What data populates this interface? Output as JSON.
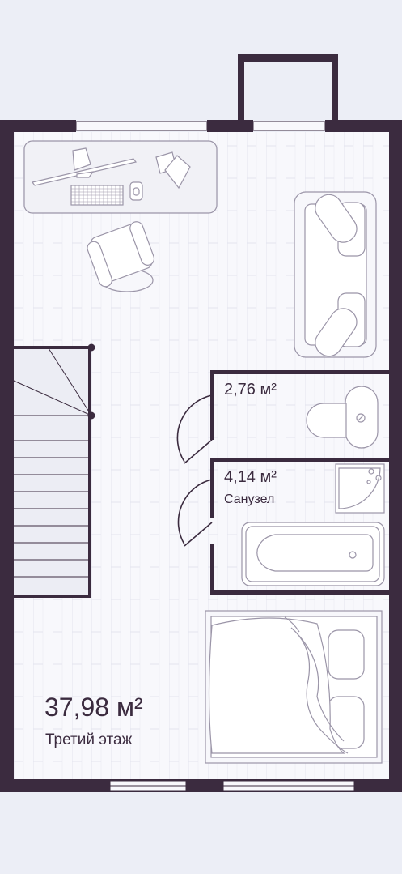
{
  "plan": {
    "floor": {
      "area": "37,98 м²",
      "name": "Третий этаж"
    },
    "rooms": [
      {
        "area": "2,76 м²"
      },
      {
        "area": "4,14 м²",
        "name": "Санузел"
      }
    ],
    "furniture_icons": [
      "desk-icon",
      "office-chair-icon",
      "sofa-icon",
      "toilet-icon",
      "shower-tray-icon",
      "bathtub-icon",
      "bed-icon"
    ]
  },
  "colors": {
    "background": "#eceef6",
    "floor": "#f7f7fb",
    "wall": "#3b2b3f",
    "furniture_stroke": "#9b95a8",
    "text": "#3b2b3f"
  }
}
